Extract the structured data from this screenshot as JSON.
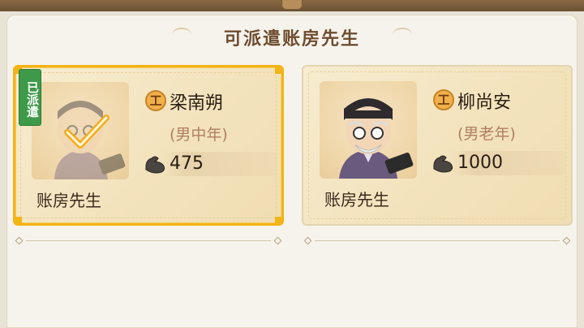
{
  "panel": {
    "title": "可派遣账房先生"
  },
  "cards": [
    {
      "name": "梁南朔",
      "attribute": "(男中年)",
      "power": "475",
      "role": "账房先生",
      "work_badge": "工",
      "dispatched_badge": "已派遣",
      "selected": true
    },
    {
      "name": "柳尚安",
      "attribute": "(男老年)",
      "power": "1000",
      "role": "账房先生",
      "work_badge": "工",
      "selected": false
    }
  ],
  "icons": {
    "work": "work-badge-icon",
    "power": "muscle-icon",
    "check": "checkmark-icon"
  },
  "colors": {
    "selected_border": "#f2b417",
    "dispatched_green": "#3d9a49",
    "attr_text": "#b07e63"
  }
}
